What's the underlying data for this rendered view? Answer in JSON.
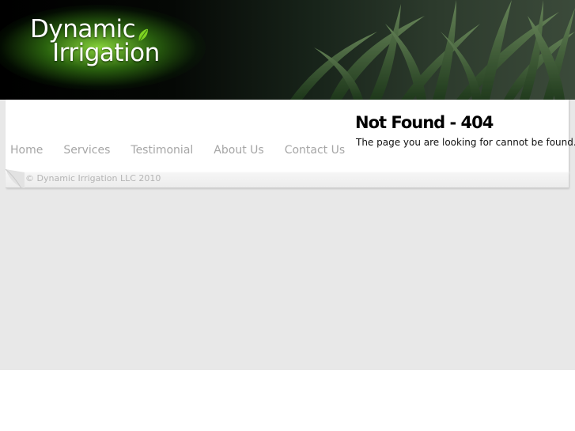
{
  "header": {
    "logo_line1": "Dynamic",
    "logo_line2": "Irrigation",
    "logo_leaf_icon": "leaf-icon",
    "accent_color": "#7ed321"
  },
  "nav": {
    "items": [
      {
        "label": "Home"
      },
      {
        "label": "Services"
      },
      {
        "label": "Testimonial"
      },
      {
        "label": "About Us"
      },
      {
        "label": "Contact Us"
      }
    ]
  },
  "main": {
    "title": "Not Found - 404",
    "message": "The page you are looking for cannot be found."
  },
  "footer": {
    "copyright": "© Dynamic Irrigation LLC 2010"
  }
}
